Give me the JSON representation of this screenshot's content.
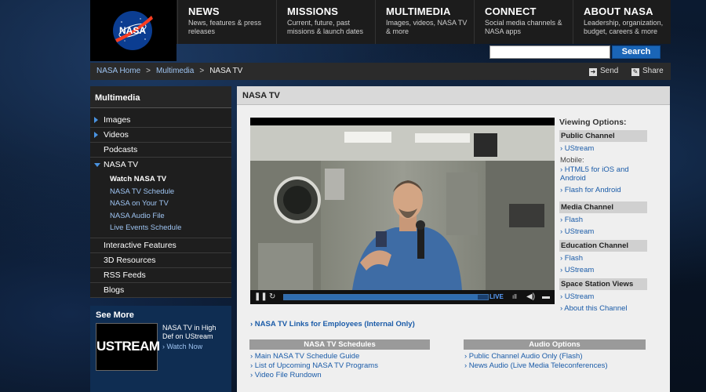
{
  "header": {
    "logo_text": "NASA",
    "nav": [
      {
        "title": "NEWS",
        "sub": "News, features & press releases"
      },
      {
        "title": "MISSIONS",
        "sub": "Current, future, past missions & launch dates"
      },
      {
        "title": "MULTIMEDIA",
        "sub": "Images, videos, NASA TV & more"
      },
      {
        "title": "CONNECT",
        "sub": "Social media channels & NASA apps"
      },
      {
        "title": "ABOUT NASA",
        "sub": "Leadership, organization, budget, careers & more"
      }
    ],
    "search": {
      "value": "",
      "button": "Search"
    }
  },
  "breadcrumb": {
    "items": [
      "NASA Home",
      "Multimedia"
    ],
    "current": "NASA TV",
    "separator": ">",
    "send": "Send",
    "share": "Share"
  },
  "sidebar": {
    "title": "Multimedia",
    "items": [
      {
        "label": "Images"
      },
      {
        "label": "Videos"
      },
      {
        "label": "Podcasts"
      },
      {
        "label": "NASA TV"
      },
      {
        "label": "Interactive Features"
      },
      {
        "label": "3D Resources"
      },
      {
        "label": "RSS Feeds"
      },
      {
        "label": "Blogs"
      }
    ],
    "sub_items": [
      "Watch NASA TV",
      "NASA TV Schedule",
      "NASA on Your TV",
      "NASA Audio File",
      "Live Events Schedule"
    ],
    "see_more": {
      "title": "See More",
      "logo_text": "USTREAM",
      "text": "NASA TV in High Def on UStream",
      "link": "› Watch Now"
    }
  },
  "main": {
    "title": "NASA TV",
    "player": {
      "live_label": "LIVE",
      "progress": 0.95
    },
    "viewing_options": {
      "title": "Viewing Options:",
      "public_head": "Public Channel",
      "public_ustream": "› UStream",
      "mobile_label": "Mobile:",
      "html5": "› HTML5 for iOS and Android",
      "flash_android": "› Flash for Android",
      "media_head": "Media Channel",
      "media_flash": "› Flash",
      "media_ustream": "› UStream",
      "edu_head": "Education Channel",
      "edu_flash": "› Flash",
      "edu_ustream": "› UStream",
      "station_head": "Space Station Views",
      "station_ustream": "› UStream",
      "station_about": "› About this Channel"
    },
    "employee_link": "› NASA TV Links for Employees (Internal Only)",
    "schedules": {
      "title": "NASA TV Schedules",
      "links": [
        "› Main NASA TV Schedule Guide",
        "› List of Upcoming NASA TV Programs",
        "› Video File Rundown"
      ]
    },
    "audio": {
      "title": "Audio Options",
      "links": [
        "› Public Channel Audio Only (Flash)",
        "› News Audio (Live Media Teleconferences)"
      ]
    }
  }
}
